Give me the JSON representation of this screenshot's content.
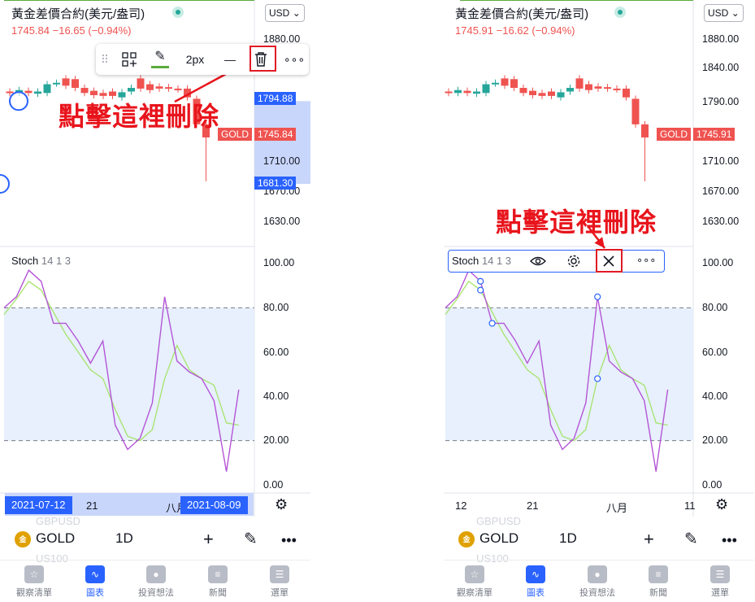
{
  "symbol_title": "黃金差價合約(美元/盎司)",
  "currency": "USD",
  "left": {
    "price": "1745.84",
    "change": "−16.65",
    "change_pct": "(−0.94%)",
    "price_axis": [
      "1880.00",
      "1794.88",
      "1745.84",
      "1710.00",
      "1681.30",
      "1670.00",
      "1630.00"
    ],
    "tag_high": "1794.88",
    "tag_low": "1681.30",
    "gold_tag": "GOLD",
    "gold_price": "1745.84",
    "toolbar": {
      "width_label": "2px"
    },
    "annotation": "點擊這裡刪除",
    "date_start": "2021-07-12",
    "date_end": "2021-08-09",
    "x_labels": [
      "21",
      "八月"
    ]
  },
  "right": {
    "price": "1745.91",
    "change": "−16.62",
    "change_pct": "(−0.94%)",
    "price_axis": [
      "1880.00",
      "1840.00",
      "1790.00",
      "1710.00",
      "1670.00",
      "1630.00"
    ],
    "gold_tag": "GOLD",
    "gold_price": "1745.91",
    "annotation": "點擊這裡刪除",
    "x_labels": [
      "12",
      "21",
      "八月",
      "11"
    ]
  },
  "stoch": {
    "name": "Stoch",
    "params": "14 1 3",
    "axis": [
      "100.00",
      "80.00",
      "60.00",
      "40.00",
      "20.00",
      "0.00"
    ]
  },
  "ghost_symbols": [
    "GBPUSD",
    "US100"
  ],
  "symbol_bar": {
    "name": "GOLD",
    "interval": "1D",
    "logo": "金"
  },
  "nav": [
    {
      "label": "觀察清單",
      "icon": "star-icon",
      "active": false
    },
    {
      "label": "圖表",
      "icon": "chart-icon",
      "active": true
    },
    {
      "label": "投資想法",
      "icon": "lightbulb-icon",
      "active": false
    },
    {
      "label": "新聞",
      "icon": "news-icon",
      "active": false
    },
    {
      "label": "選單",
      "icon": "menu-icon",
      "active": false
    }
  ],
  "colors": {
    "up": "#26a69a",
    "down": "#ef5350",
    "accent": "#2962ff",
    "trendline": "#5aab3e",
    "stoch_k": "#b455d6",
    "stoch_d": "#a6e36b",
    "annotation": "#e8141c"
  },
  "chart_data": {
    "type": "candlestick",
    "candles": [
      {
        "o": 1808,
        "c": 1806
      },
      {
        "o": 1806,
        "c": 1810
      },
      {
        "o": 1809,
        "c": 1806
      },
      {
        "o": 1805,
        "c": 1808
      },
      {
        "o": 1806,
        "c": 1818
      },
      {
        "o": 1819,
        "c": 1820
      },
      {
        "o": 1826,
        "c": 1816
      },
      {
        "o": 1825,
        "c": 1813
      },
      {
        "o": 1813,
        "c": 1806
      },
      {
        "o": 1809,
        "c": 1803
      },
      {
        "o": 1806,
        "c": 1802
      },
      {
        "o": 1808,
        "c": 1802
      },
      {
        "o": 1800,
        "c": 1807
      },
      {
        "o": 1808,
        "c": 1813
      },
      {
        "o": 1826,
        "c": 1812
      },
      {
        "o": 1818,
        "c": 1810
      },
      {
        "o": 1815,
        "c": 1812
      },
      {
        "o": 1814,
        "c": 1812
      },
      {
        "o": 1812,
        "c": 1811
      },
      {
        "o": 1812,
        "c": 1800
      },
      {
        "o": 1798,
        "c": 1763
      },
      {
        "o": 1763,
        "c": 1745
      }
    ],
    "stoch_k": [
      80,
      85,
      97,
      92,
      73,
      73,
      65,
      55,
      65,
      27,
      16,
      21,
      37,
      85,
      56,
      51,
      48,
      38,
      6,
      43
    ],
    "stoch_d": [
      77,
      84,
      92,
      88,
      78,
      68,
      60,
      52,
      48,
      34,
      22,
      20,
      25,
      48,
      63,
      52,
      48,
      45,
      28,
      27
    ],
    "stoch_levels": [
      80,
      20
    ],
    "trendline": {
      "from": 1794.88,
      "to": 1681.3
    }
  }
}
